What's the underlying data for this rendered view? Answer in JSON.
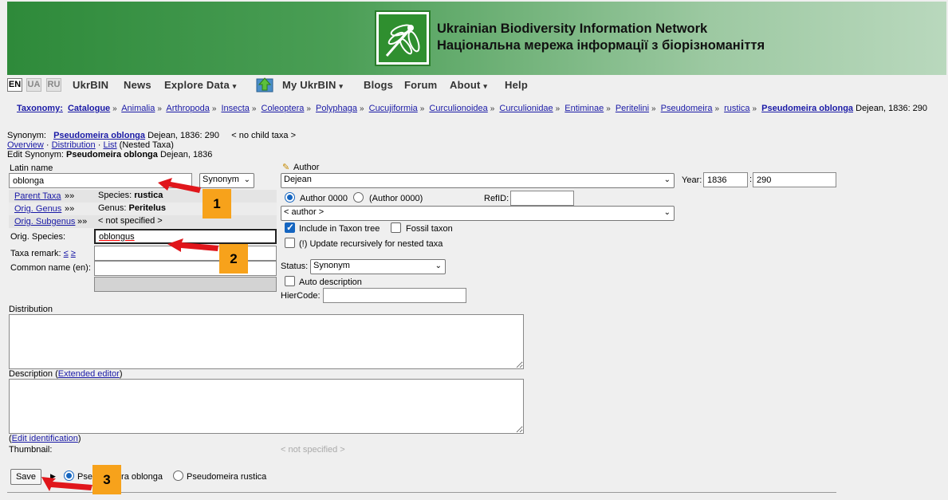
{
  "header": {
    "title_en": "Ukrainian Biodiversity Information Network",
    "title_ua": "Національна мережа інформації з біорізноманіття",
    "logo_icon": "dragonfly-logo-icon"
  },
  "nav": {
    "languages": [
      "EN",
      "UA",
      "RU"
    ],
    "active_language": "EN",
    "items": [
      {
        "label": "UkrBIN",
        "dropdown": false
      },
      {
        "label": "News",
        "dropdown": false
      },
      {
        "label": "Explore Data",
        "dropdown": true
      },
      {
        "label": "My UkrBIN",
        "dropdown": true
      },
      {
        "label": "Blogs",
        "dropdown": false
      },
      {
        "label": "Forum",
        "dropdown": false
      },
      {
        "label": "About",
        "dropdown": true
      },
      {
        "label": "Help",
        "dropdown": false
      }
    ],
    "caret": "▾"
  },
  "breadcrumb": {
    "lead": "Taxonomy:",
    "items": [
      "Catalogue",
      "Animalia",
      "Arthropoda",
      "Insecta",
      "Coleoptera",
      "Polyphaga",
      "Cucujiformia",
      "Curculionoidea",
      "Curculionidae",
      "Entiminae",
      "Peritelini",
      "Pseudomeira",
      "rustica"
    ],
    "current": "Pseudomeira oblonga",
    "current_suffix": "Dejean, 1836: 290",
    "separator": "»"
  },
  "synonym_line": {
    "prefix": "Synonym:",
    "name": "Pseudomeira oblonga",
    "author": "Dejean, 1836: 290",
    "child": "< no child taxa >"
  },
  "links_line": {
    "overview": "Overview",
    "distribution": "Distribution",
    "list": "List",
    "nested": "(Nested Taxa)",
    "dot": "·"
  },
  "edit_line": {
    "prefix": "Edit Synonym:",
    "name": "Pseudomeira oblonga",
    "author": "Dejean, 1836"
  },
  "form": {
    "latin_name_label": "Latin name",
    "latin_name_value": "oblonga",
    "rank_select": "Synonym",
    "parent_taxa_link": "Parent Taxa",
    "parent_taxa_value_prefix": "Species:",
    "parent_taxa_value": "rustica",
    "orig_genus_link": "Orig. Genus",
    "orig_genus_value_prefix": "Genus:",
    "orig_genus_value": "Peritelus",
    "orig_subgenus_link": "Orig. Subgenus",
    "orig_subgenus_value": "< not specified >",
    "chevrons": "»»",
    "orig_species_label": "Orig. Species:",
    "orig_species_value": "oblongus",
    "taxa_remark_label": "Taxa remark:",
    "taxa_remark_link1": "≤",
    "taxa_remark_link2": "≥",
    "common_name_label": "Common name (en):",
    "author_label": "Author",
    "author_select": "Dejean",
    "year_label": "Year:",
    "year_value": "1836",
    "page_value": "290",
    "author_format_1": "Author 0000",
    "author_format_2": "(Author 0000)",
    "refid_label": "RefID:",
    "author_list_select": "< author >",
    "include_tree_label": "Include in Taxon tree",
    "fossil_label": "Fossil taxon",
    "update_recursive_label": "(!) Update recursively for nested taxa",
    "status_label": "Status:",
    "status_select": "Synonym",
    "auto_description_label": "Auto description",
    "hiercode_label": "HierCode:",
    "distribution_label": "Distribution",
    "description_label": "Description (",
    "extended_editor_link": "Extended editor",
    "description_label_close": ")",
    "edit_identification_open": "(",
    "edit_identification_link": "Edit identification",
    "edit_identification_close": ")",
    "thumbnail_label": "Thumbnail:",
    "thumbnail_value": "< not specified >",
    "save_button": "Save",
    "save_target_1": "Pseudomeira oblonga",
    "save_target_2": "Pseudomeira rustica"
  },
  "annotations": {
    "badge_1": "1",
    "badge_2": "2",
    "badge_3": "3",
    "badge_color": "#f7a21b",
    "arrow_color": "#e0161b"
  }
}
